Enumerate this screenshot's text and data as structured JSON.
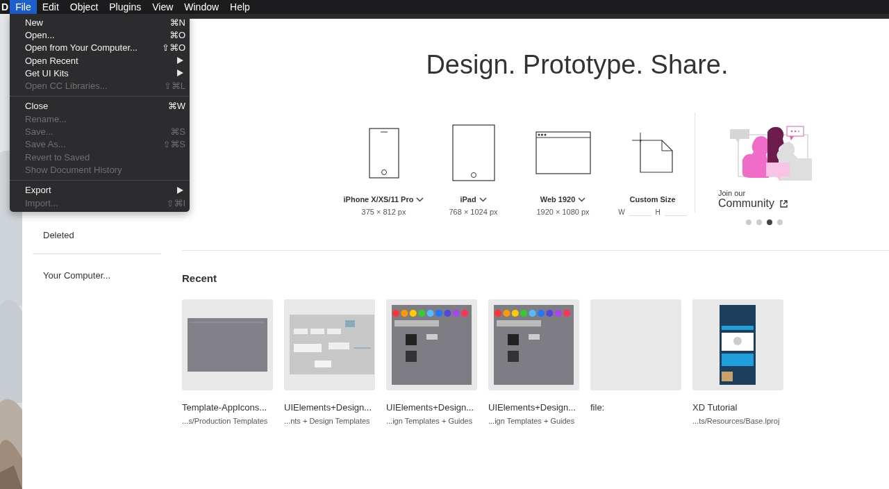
{
  "menu_bar": {
    "app": "D",
    "items": [
      {
        "label": "File",
        "selected": true
      },
      {
        "label": "Edit",
        "selected": false
      },
      {
        "label": "Object",
        "selected": false
      },
      {
        "label": "Plugins",
        "selected": false
      },
      {
        "label": "View",
        "selected": false
      },
      {
        "label": "Window",
        "selected": false
      },
      {
        "label": "Help",
        "selected": false
      }
    ]
  },
  "file_menu": [
    {
      "kind": "item",
      "label": "New",
      "shortcut": "⌘N",
      "disabled": false,
      "submenu": false
    },
    {
      "kind": "item",
      "label": "Open...",
      "shortcut": "⌘O",
      "disabled": false,
      "submenu": false
    },
    {
      "kind": "item",
      "label": "Open from Your Computer...",
      "shortcut": "⇧⌘O",
      "disabled": false,
      "submenu": false
    },
    {
      "kind": "item",
      "label": "Open Recent",
      "disabled": false,
      "submenu": true
    },
    {
      "kind": "item",
      "label": "Get UI Kits",
      "disabled": false,
      "submenu": true
    },
    {
      "kind": "item",
      "label": "Open CC Libraries...",
      "shortcut": "⇧⌘L",
      "disabled": true,
      "submenu": false
    },
    {
      "kind": "separator"
    },
    {
      "kind": "item",
      "label": "Close",
      "shortcut": "⌘W",
      "disabled": false,
      "submenu": false
    },
    {
      "kind": "item",
      "label": "Rename...",
      "disabled": true,
      "submenu": false
    },
    {
      "kind": "item",
      "label": "Save...",
      "shortcut": "⌘S",
      "disabled": true,
      "submenu": false
    },
    {
      "kind": "item",
      "label": "Save As...",
      "shortcut": "⇧⌘S",
      "disabled": true,
      "submenu": false
    },
    {
      "kind": "item",
      "label": "Revert to Saved",
      "disabled": true,
      "submenu": false
    },
    {
      "kind": "item",
      "label": "Show Document History",
      "disabled": true,
      "submenu": false
    },
    {
      "kind": "separator"
    },
    {
      "kind": "item",
      "label": "Export",
      "disabled": false,
      "submenu": true
    },
    {
      "kind": "item",
      "label": "Import...",
      "shortcut": "⇧⌘I",
      "disabled": true,
      "submenu": false
    }
  ],
  "sidebar": {
    "items": [
      {
        "kind": "link",
        "label": "Deleted"
      },
      {
        "kind": "divider"
      },
      {
        "kind": "link",
        "label": "Your Computer..."
      }
    ]
  },
  "headline": "Design. Prototype. Share.",
  "presets": [
    {
      "kind": "phone",
      "label": "iPhone X/XS/11 Pro",
      "dropdown": true,
      "size": "375 × 812 px"
    },
    {
      "kind": "tablet",
      "label": "iPad",
      "dropdown": true,
      "size": "768 × 1024 px"
    },
    {
      "kind": "browser",
      "label": "Web 1920",
      "dropdown": true,
      "size": "1920 × 1080 px"
    },
    {
      "kind": "custom",
      "label": "Custom Size",
      "dropdown": false,
      "width_label": "W",
      "height_label": "H"
    }
  ],
  "community": {
    "kicker": "Join our",
    "title": "Community",
    "pages": [
      {
        "selected": false
      },
      {
        "selected": false
      },
      {
        "selected": true
      },
      {
        "selected": false
      }
    ]
  },
  "recent": {
    "title": "Recent",
    "items": [
      {
        "kind": "dark-artboard",
        "name": "Template-AppIcons...",
        "path": "...s/Production Templates"
      },
      {
        "kind": "ui-sheet",
        "name": "UIElements+Design...",
        "path": "...nts + Design Templates"
      },
      {
        "kind": "color-grid",
        "name": "UIElements+Design...",
        "path": "...ign Templates + Guides"
      },
      {
        "kind": "color-grid",
        "name": "UIElements+Design...",
        "path": "...ign Templates + Guides"
      },
      {
        "kind": "empty",
        "name": "file:"
      },
      {
        "kind": "phone-app",
        "name": "XD Tutorial",
        "path": "...ts/Resources/Base.lproj"
      }
    ]
  }
}
